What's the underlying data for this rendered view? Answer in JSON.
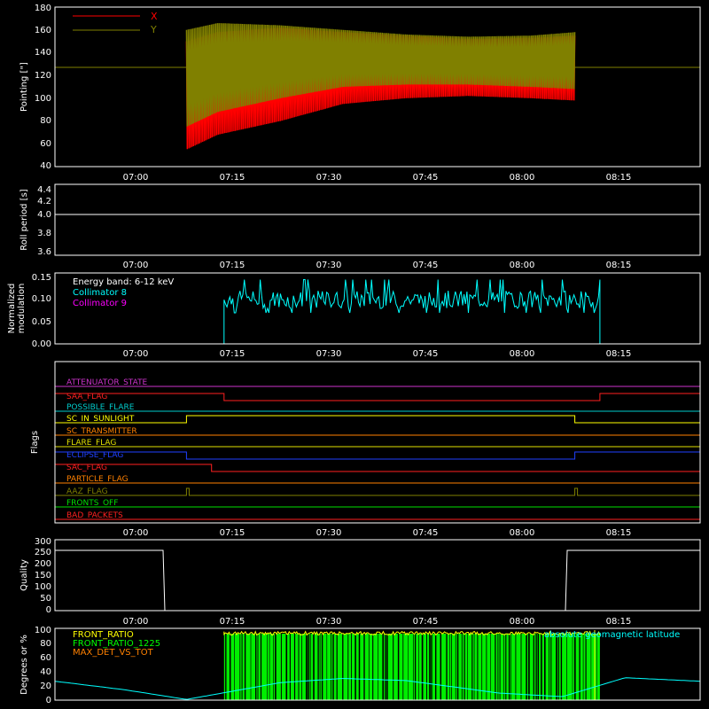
{
  "x_ticks": [
    "07:00",
    "07:15",
    "07:30",
    "07:45",
    "08:00",
    "08:15"
  ],
  "panels": {
    "pointing": {
      "ylabel": "Pointing [\"]",
      "yticks": [
        "40",
        "60",
        "80",
        "100",
        "120",
        "140",
        "160",
        "180"
      ],
      "legend": [
        {
          "label": "X",
          "color": "#ff0000"
        },
        {
          "label": "Y",
          "color": "#808000"
        }
      ]
    },
    "roll": {
      "ylabel": "Roll period [s]",
      "yticks": [
        "3.6",
        "3.8",
        "4.0",
        "4.2",
        "4.4"
      ]
    },
    "modulation": {
      "ylabel_line1": "Normalized",
      "ylabel_line2": "modulation",
      "yticks": [
        "0.00",
        "0.05",
        "0.10",
        "0.15"
      ],
      "legend": [
        {
          "label": "Energy band: 6-12 keV",
          "color": "#ffffff"
        },
        {
          "label": "Collimator 8",
          "color": "#00ffff"
        },
        {
          "label": "Collimator 9",
          "color": "#ff00ff"
        }
      ]
    },
    "flags": {
      "ylabel": "Flags",
      "items": [
        {
          "label": "ATTENUATOR_STATE",
          "color": "#cc33cc"
        },
        {
          "label": "SAA_FLAG",
          "color": "#ff2020"
        },
        {
          "label": "POSSIBLE_FLARE",
          "color": "#00cccc"
        },
        {
          "label": "SC_IN_SUNLIGHT",
          "color": "#ffff00"
        },
        {
          "label": "SC_TRANSMITTER",
          "color": "#ff8000"
        },
        {
          "label": "FLARE_FLAG",
          "color": "#e0e000"
        },
        {
          "label": "ECLIPSE_FLAG",
          "color": "#2040ff"
        },
        {
          "label": "SAC_FLAG",
          "color": "#ff2020"
        },
        {
          "label": "PARTICLE_FLAG",
          "color": "#ff8000"
        },
        {
          "label": "AAZ_FLAG",
          "color": "#808000"
        },
        {
          "label": "FRONTS_OFF",
          "color": "#00e000"
        },
        {
          "label": "BAD_PACKETS",
          "color": "#ff2020"
        }
      ]
    },
    "quality": {
      "ylabel": "Quality",
      "yticks": [
        "0",
        "50",
        "100",
        "150",
        "200",
        "250",
        "300"
      ]
    },
    "geo": {
      "ylabel": "Degrees or %",
      "yticks": [
        "0",
        "20",
        "40",
        "60",
        "80",
        "100"
      ],
      "legend": [
        {
          "label": "FRONT_RATIO",
          "color": "#ffff00"
        },
        {
          "label": "FRONT_RATIO_1225",
          "color": "#00ff00"
        },
        {
          "label": "MAX_DET_VS_TOT",
          "color": "#ff8000"
        }
      ],
      "annotation": "absolute geomagnetic latitude",
      "annotation_color": "#00ffff"
    }
  },
  "chart_data": [
    {
      "type": "line",
      "xlim": [
        "06:44",
        "08:27"
      ],
      "ylim": [
        40,
        180
      ],
      "series": [
        {
          "name": "X",
          "color": "#ff0000",
          "x": [
            "07:05",
            "07:10",
            "07:20",
            "07:30",
            "07:40",
            "07:50",
            "08:00",
            "08:07"
          ],
          "y_min": [
            55,
            68,
            80,
            95,
            100,
            102,
            100,
            98
          ],
          "y_max": [
            150,
            158,
            162,
            158,
            155,
            152,
            153,
            155
          ]
        },
        {
          "name": "Y",
          "color": "#808000",
          "x": [
            "07:05",
            "07:10",
            "07:20",
            "07:30",
            "07:40",
            "07:50",
            "08:00",
            "08:07"
          ],
          "y_min": [
            75,
            88,
            100,
            110,
            112,
            112,
            110,
            108
          ],
          "y_max": [
            160,
            166,
            164,
            160,
            156,
            154,
            155,
            158
          ]
        }
      ],
      "reference_line": 128
    },
    {
      "type": "line",
      "xlim": [
        "06:44",
        "08:27"
      ],
      "ylim": [
        3.5,
        4.5
      ],
      "series": [
        {
          "x": [
            "06:44",
            "08:27"
          ],
          "y": [
            4.05,
            4.05
          ],
          "color": "#ffffff"
        }
      ]
    },
    {
      "type": "line",
      "xlim": [
        "06:44",
        "08:27"
      ],
      "ylim": [
        0,
        0.16
      ],
      "series": [
        {
          "name": "Collimator 8",
          "color": "#00ffff",
          "x_start": "07:11",
          "x_end": "08:11",
          "level": 0.1,
          "noise": 0.02
        },
        {
          "name": "Collimator 9",
          "color": "#ff00ff",
          "level": 0
        }
      ]
    },
    {
      "type": "step",
      "xlim": [
        "06:44",
        "08:27"
      ],
      "flags": [
        {
          "name": "ATTENUATOR_STATE",
          "on": []
        },
        {
          "name": "SAA_FLAG",
          "on": [
            [
              "06:44",
              "07:11"
            ],
            [
              "08:11",
              "08:27"
            ]
          ]
        },
        {
          "name": "POSSIBLE_FLARE",
          "on": []
        },
        {
          "name": "SC_IN_SUNLIGHT",
          "on": [
            [
              "07:05",
              "08:07"
            ]
          ]
        },
        {
          "name": "SC_TRANSMITTER",
          "on": []
        },
        {
          "name": "FLARE_FLAG",
          "on": []
        },
        {
          "name": "ECLIPSE_FLAG",
          "on": [
            [
              "06:44",
              "07:05"
            ],
            [
              "08:07",
              "08:27"
            ]
          ]
        },
        {
          "name": "SAC_FLAG",
          "on": [
            [
              "06:44",
              "07:09"
            ]
          ]
        },
        {
          "name": "PARTICLE_FLAG",
          "on": []
        },
        {
          "name": "AAZ_FLAG",
          "on": [
            [
              "07:05",
              "07:05"
            ],
            [
              "08:07",
              "08:07"
            ]
          ]
        },
        {
          "name": "FRONTS_OFF",
          "on": []
        },
        {
          "name": "BAD_PACKETS",
          "on": []
        }
      ]
    },
    {
      "type": "step",
      "xlim": [
        "06:44",
        "08:27"
      ],
      "ylim": [
        0,
        300
      ],
      "series": [
        {
          "x": [
            "06:44",
            "07:05",
            "07:05",
            "08:07",
            "08:07",
            "08:27"
          ],
          "y": [
            255,
            255,
            0,
            0,
            255,
            255
          ],
          "color": "#ffffff"
        }
      ]
    },
    {
      "type": "line",
      "xlim": [
        "06:44",
        "08:27"
      ],
      "ylim": [
        0,
        100
      ],
      "series": [
        {
          "name": "absolute geomagnetic latitude",
          "color": "#00ffff",
          "x": [
            "06:44",
            "06:55",
            "07:05",
            "07:20",
            "07:30",
            "07:40",
            "07:55",
            "08:05",
            "08:15",
            "08:27"
          ],
          "y": [
            27,
            15,
            1,
            25,
            31,
            28,
            10,
            5,
            32,
            27
          ]
        },
        {
          "name": "FRONT_RATIO_1225",
          "color": "#00ff00",
          "x_start": "07:11",
          "x_end": "08:11",
          "level": 95
        },
        {
          "name": "FRONT_RATIO",
          "color": "#ffff00",
          "x_start": "07:11",
          "x_end": "08:11",
          "level": 98
        }
      ]
    }
  ]
}
